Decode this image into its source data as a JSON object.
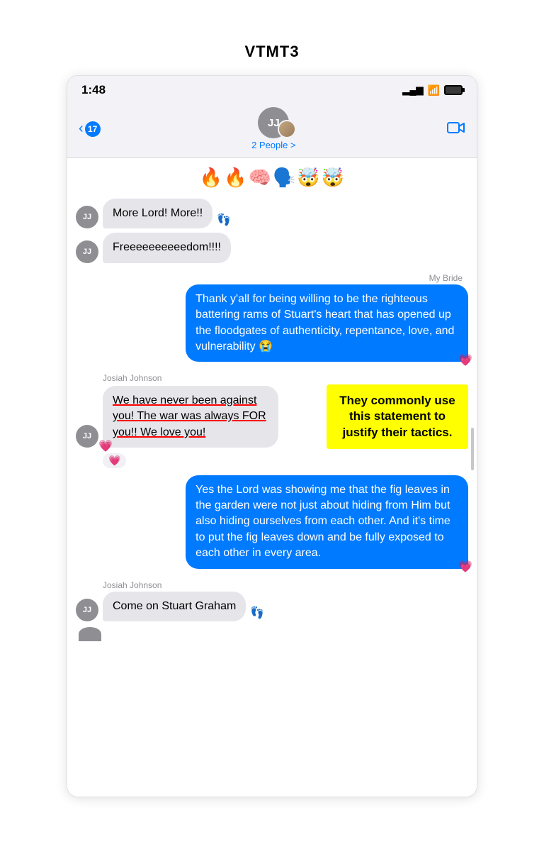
{
  "page": {
    "title": "VTMT3"
  },
  "statusBar": {
    "time": "1:48",
    "signal": "▂▄▆",
    "wifi": "WiFi",
    "battery": "battery"
  },
  "navBar": {
    "backCount": "17",
    "avatarInitials": "JJ",
    "peopleLabel": "2 People >",
    "videoButton": "video"
  },
  "chat": {
    "emojiRow": "🔥🔥🧠🗣️🤯🤯",
    "messages": [
      {
        "id": "msg1",
        "side": "left",
        "avatar": "JJ",
        "text": "More Lord! More!!",
        "deliveredIcon": true
      },
      {
        "id": "msg2",
        "side": "left",
        "avatar": "JJ",
        "text": "Freeeeeeeeeedom!!!!"
      },
      {
        "id": "msg3",
        "side": "right",
        "senderLabel": "My Bride",
        "text": "Thank y'all for being willing to be the righteous battering rams of Stuart's heart that has opened up the floodgates of authenticity, repentance, love, and vulnerability 😭",
        "hasHeartReaction": true
      },
      {
        "id": "msg4",
        "side": "left",
        "senderLabel": "Josiah Johnson",
        "avatar": "JJ",
        "text": "We have never been against you! The war was always FOR you!! We love you!",
        "underlined": true,
        "hasHeartReaction": true,
        "annotation": "They commonly use this statement to justify their tactics."
      },
      {
        "id": "msg5",
        "side": "right",
        "text": "Yes the Lord was showing me that the fig leaves in the garden were not just about hiding from Him but also hiding ourselves from each other. And it's time to put the fig leaves down and be fully exposed to each other in every area.",
        "hasHeartReaction": true
      },
      {
        "id": "msg6",
        "side": "left",
        "senderLabel": "Josiah Johnson",
        "avatar": "JJ",
        "text": "Come on Stuart Graham",
        "deliveredIcon": true
      }
    ]
  }
}
